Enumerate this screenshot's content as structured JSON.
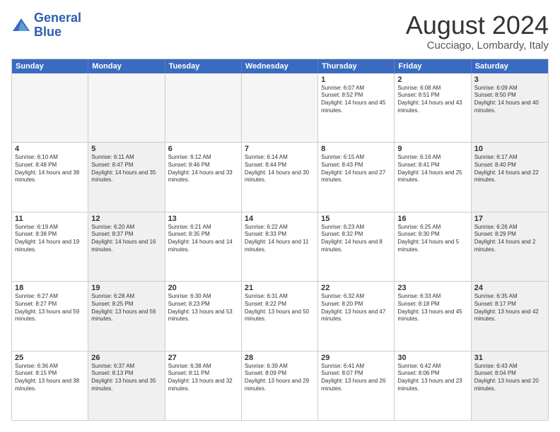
{
  "logo": {
    "line1": "General",
    "line2": "Blue"
  },
  "title": "August 2024",
  "location": "Cucciago, Lombardy, Italy",
  "header_days": [
    "Sunday",
    "Monday",
    "Tuesday",
    "Wednesday",
    "Thursday",
    "Friday",
    "Saturday"
  ],
  "rows": [
    [
      {
        "day": "",
        "info": "",
        "shaded": true
      },
      {
        "day": "",
        "info": "",
        "shaded": true
      },
      {
        "day": "",
        "info": "",
        "shaded": true
      },
      {
        "day": "",
        "info": "",
        "shaded": true
      },
      {
        "day": "1",
        "info": "Sunrise: 6:07 AM\nSunset: 8:52 PM\nDaylight: 14 hours and 45 minutes."
      },
      {
        "day": "2",
        "info": "Sunrise: 6:08 AM\nSunset: 8:51 PM\nDaylight: 14 hours and 43 minutes."
      },
      {
        "day": "3",
        "info": "Sunrise: 6:09 AM\nSunset: 8:50 PM\nDaylight: 14 hours and 40 minutes.",
        "shaded": true
      }
    ],
    [
      {
        "day": "4",
        "info": "Sunrise: 6:10 AM\nSunset: 8:48 PM\nDaylight: 14 hours and 38 minutes."
      },
      {
        "day": "5",
        "info": "Sunrise: 6:11 AM\nSunset: 8:47 PM\nDaylight: 14 hours and 35 minutes.",
        "shaded": true
      },
      {
        "day": "6",
        "info": "Sunrise: 6:12 AM\nSunset: 8:46 PM\nDaylight: 14 hours and 33 minutes."
      },
      {
        "day": "7",
        "info": "Sunrise: 6:14 AM\nSunset: 8:44 PM\nDaylight: 14 hours and 30 minutes."
      },
      {
        "day": "8",
        "info": "Sunrise: 6:15 AM\nSunset: 8:43 PM\nDaylight: 14 hours and 27 minutes."
      },
      {
        "day": "9",
        "info": "Sunrise: 6:16 AM\nSunset: 8:41 PM\nDaylight: 14 hours and 25 minutes."
      },
      {
        "day": "10",
        "info": "Sunrise: 6:17 AM\nSunset: 8:40 PM\nDaylight: 14 hours and 22 minutes.",
        "shaded": true
      }
    ],
    [
      {
        "day": "11",
        "info": "Sunrise: 6:19 AM\nSunset: 8:38 PM\nDaylight: 14 hours and 19 minutes."
      },
      {
        "day": "12",
        "info": "Sunrise: 6:20 AM\nSunset: 8:37 PM\nDaylight: 14 hours and 16 minutes.",
        "shaded": true
      },
      {
        "day": "13",
        "info": "Sunrise: 6:21 AM\nSunset: 8:35 PM\nDaylight: 14 hours and 14 minutes."
      },
      {
        "day": "14",
        "info": "Sunrise: 6:22 AM\nSunset: 8:33 PM\nDaylight: 14 hours and 11 minutes."
      },
      {
        "day": "15",
        "info": "Sunrise: 6:23 AM\nSunset: 8:32 PM\nDaylight: 14 hours and 8 minutes."
      },
      {
        "day": "16",
        "info": "Sunrise: 6:25 AM\nSunset: 8:30 PM\nDaylight: 14 hours and 5 minutes."
      },
      {
        "day": "17",
        "info": "Sunrise: 6:26 AM\nSunset: 8:29 PM\nDaylight: 14 hours and 2 minutes.",
        "shaded": true
      }
    ],
    [
      {
        "day": "18",
        "info": "Sunrise: 6:27 AM\nSunset: 8:27 PM\nDaylight: 13 hours and 59 minutes."
      },
      {
        "day": "19",
        "info": "Sunrise: 6:28 AM\nSunset: 8:25 PM\nDaylight: 13 hours and 56 minutes.",
        "shaded": true
      },
      {
        "day": "20",
        "info": "Sunrise: 6:30 AM\nSunset: 8:23 PM\nDaylight: 13 hours and 53 minutes."
      },
      {
        "day": "21",
        "info": "Sunrise: 6:31 AM\nSunset: 8:22 PM\nDaylight: 13 hours and 50 minutes."
      },
      {
        "day": "22",
        "info": "Sunrise: 6:32 AM\nSunset: 8:20 PM\nDaylight: 13 hours and 47 minutes."
      },
      {
        "day": "23",
        "info": "Sunrise: 6:33 AM\nSunset: 8:18 PM\nDaylight: 13 hours and 45 minutes."
      },
      {
        "day": "24",
        "info": "Sunrise: 6:35 AM\nSunset: 8:17 PM\nDaylight: 13 hours and 42 minutes.",
        "shaded": true
      }
    ],
    [
      {
        "day": "25",
        "info": "Sunrise: 6:36 AM\nSunset: 8:15 PM\nDaylight: 13 hours and 38 minutes."
      },
      {
        "day": "26",
        "info": "Sunrise: 6:37 AM\nSunset: 8:13 PM\nDaylight: 13 hours and 35 minutes.",
        "shaded": true
      },
      {
        "day": "27",
        "info": "Sunrise: 6:38 AM\nSunset: 8:11 PM\nDaylight: 13 hours and 32 minutes."
      },
      {
        "day": "28",
        "info": "Sunrise: 6:39 AM\nSunset: 8:09 PM\nDaylight: 13 hours and 29 minutes."
      },
      {
        "day": "29",
        "info": "Sunrise: 6:41 AM\nSunset: 8:07 PM\nDaylight: 13 hours and 26 minutes."
      },
      {
        "day": "30",
        "info": "Sunrise: 6:42 AM\nSunset: 8:06 PM\nDaylight: 13 hours and 23 minutes."
      },
      {
        "day": "31",
        "info": "Sunrise: 6:43 AM\nSunset: 8:04 PM\nDaylight: 13 hours and 20 minutes.",
        "shaded": true
      }
    ]
  ]
}
